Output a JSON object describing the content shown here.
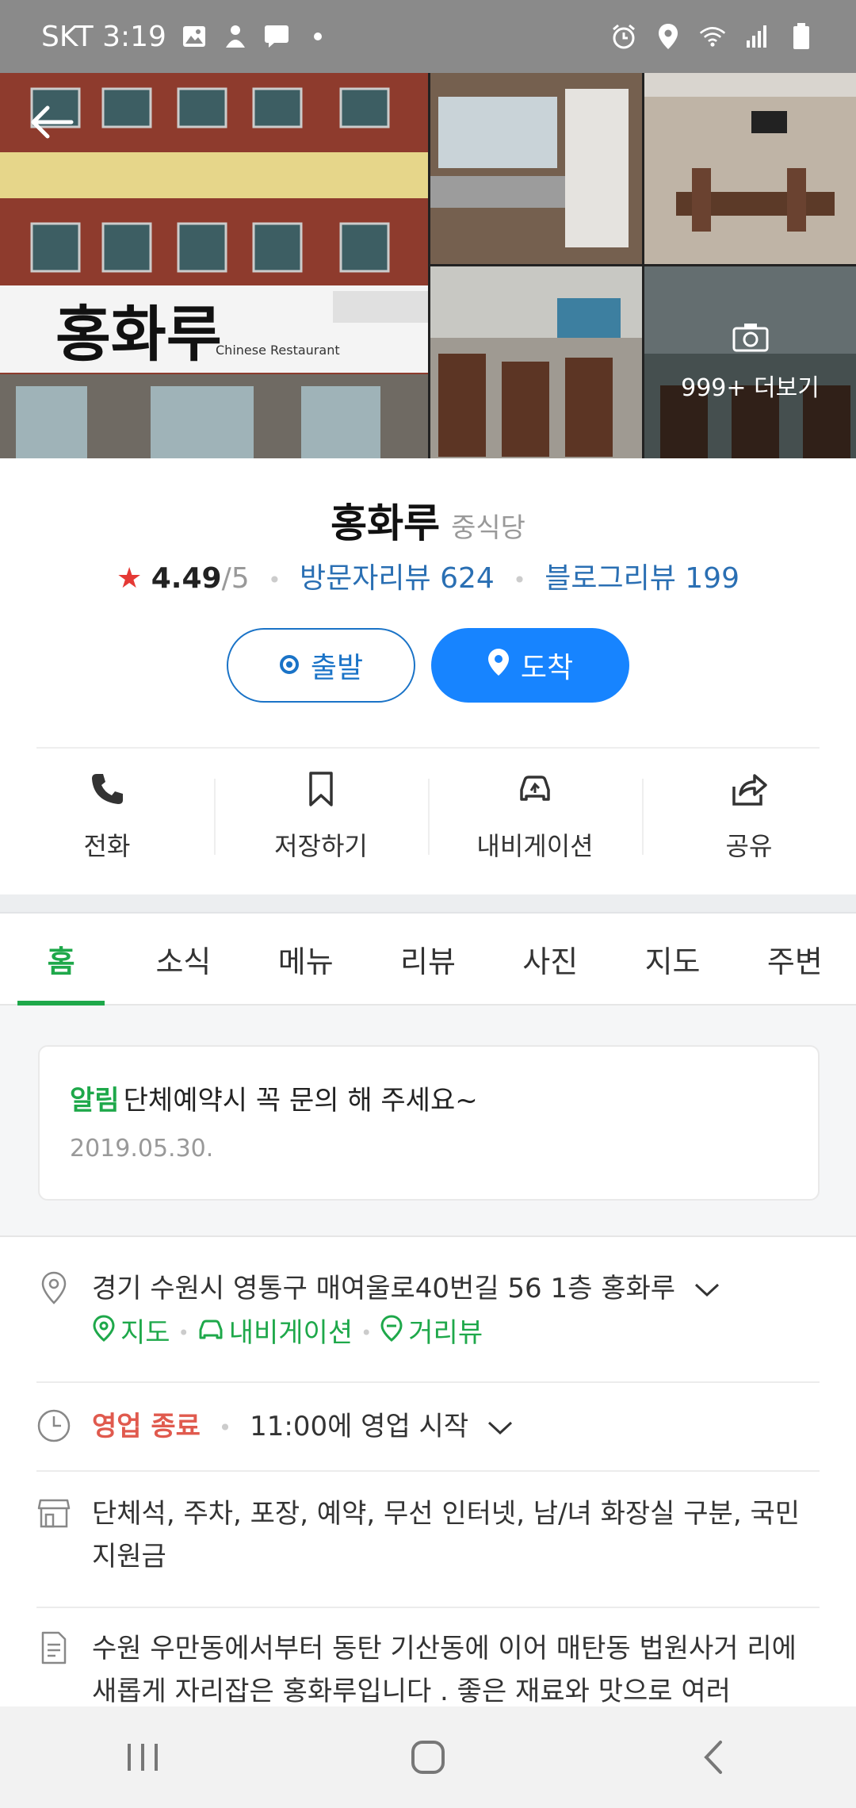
{
  "status_bar": {
    "carrier_time": "SKT 3:19",
    "left_icons": [
      "gallery-icon",
      "notification-app-icon",
      "chat-icon",
      "dot-icon"
    ],
    "right_icons": [
      "alarm-icon",
      "location-icon",
      "wifi-icon",
      "signal-icon",
      "battery-icon"
    ]
  },
  "photos": {
    "sign_main": "홍화루",
    "sign_sub": "Chinese Restaurant",
    "more_label": "999+ 더보기"
  },
  "place": {
    "name": "홍화루",
    "category": "중식당",
    "rating_score": "4.49",
    "rating_outof": "/5",
    "visitor_reviews": "방문자리뷰 624",
    "blog_reviews": "블로그리뷰 199"
  },
  "buttons": {
    "depart": "출발",
    "arrive": "도착"
  },
  "actions": {
    "call": "전화",
    "save": "저장하기",
    "navigate": "내비게이션",
    "share": "공유"
  },
  "tabs": [
    "홈",
    "소식",
    "메뉴",
    "리뷰",
    "사진",
    "지도",
    "주변"
  ],
  "notice": {
    "label": "알림",
    "text": "단체예약시 꼭 문의 해 주세요~",
    "date": "2019.05.30."
  },
  "address": {
    "text": "경기 수원시 영통구 매여울로40번길 56 1층 홍화루",
    "map": "지도",
    "navigation": "내비게이션",
    "street_view": "거리뷰"
  },
  "hours": {
    "status": "영업 종료",
    "next": "11:00에 영업 시작"
  },
  "amenities": "단체석, 주차, 포장, 예약, 무선 인터넷, 남/녀 화장실 구분, 국민지원금",
  "description": "수원 우만동에서부터 동탄 기산동에 이어 매탄동 법원사거 리에 새롭게 자리잡은 홍화루입니다 . 좋은 재료와 맛으로 여러"
}
